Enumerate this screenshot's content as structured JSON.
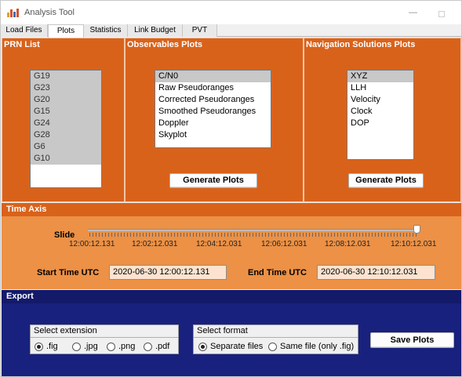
{
  "window": {
    "title": "Analysis Tool",
    "minimize_glyph": "—",
    "maximize_glyph": ""
  },
  "tabs": [
    {
      "label": "Load Files",
      "active": false
    },
    {
      "label": "Plots",
      "active": true
    },
    {
      "label": "Statistics",
      "active": false
    },
    {
      "label": "Link Budget",
      "active": false
    },
    {
      "label": "PVT",
      "active": false
    }
  ],
  "prn_panel": {
    "title": "PRN List",
    "items": [
      "G19",
      "G23",
      "G20",
      "G15",
      "G24",
      "G28",
      "G6",
      "G10"
    ]
  },
  "observables_panel": {
    "title": "Observables Plots",
    "items": [
      "C/N0",
      "Raw Pseudoranges",
      "Corrected Pseudoranges",
      "Smoothed Pseudoranges",
      "Doppler",
      "Skyplot"
    ],
    "selected_index": 0,
    "button_label": "Generate Plots"
  },
  "navigation_panel": {
    "title": "Navigation Solutions Plots",
    "items": [
      "XYZ",
      "LLH",
      "Velocity",
      "Clock",
      "DOP"
    ],
    "selected_index": 0,
    "button_label": "Generate Plots"
  },
  "time_axis": {
    "title": "Time Axis",
    "slide_label": "Slide",
    "slider_position": 1.0,
    "tick_labels": [
      "12:00:12.131",
      "12:02:12.031",
      "12:04:12.031",
      "12:06:12.031",
      "12:08:12.031",
      "12:10:12.031"
    ],
    "start_label": "Start Time UTC",
    "start_value": "2020-06-30 12:00:12.131",
    "end_label": "End Time UTC",
    "end_value": "2020-06-30 12:10:12.031"
  },
  "export": {
    "title": "Export",
    "extension_group": {
      "title": "Select extension",
      "options": [
        ".fig",
        ".jpg",
        ".png",
        ".pdf"
      ],
      "selected": ".fig"
    },
    "format_group": {
      "title": "Select format",
      "options": [
        "Separate files",
        "Same file (only .fig)"
      ],
      "selected": "Separate files"
    },
    "save_label": "Save Plots"
  },
  "colors": {
    "orange_panel": "#d9621b",
    "light_orange": "#ec9146",
    "export_blue": "#18217d",
    "input_bg": "#fde3cf"
  }
}
